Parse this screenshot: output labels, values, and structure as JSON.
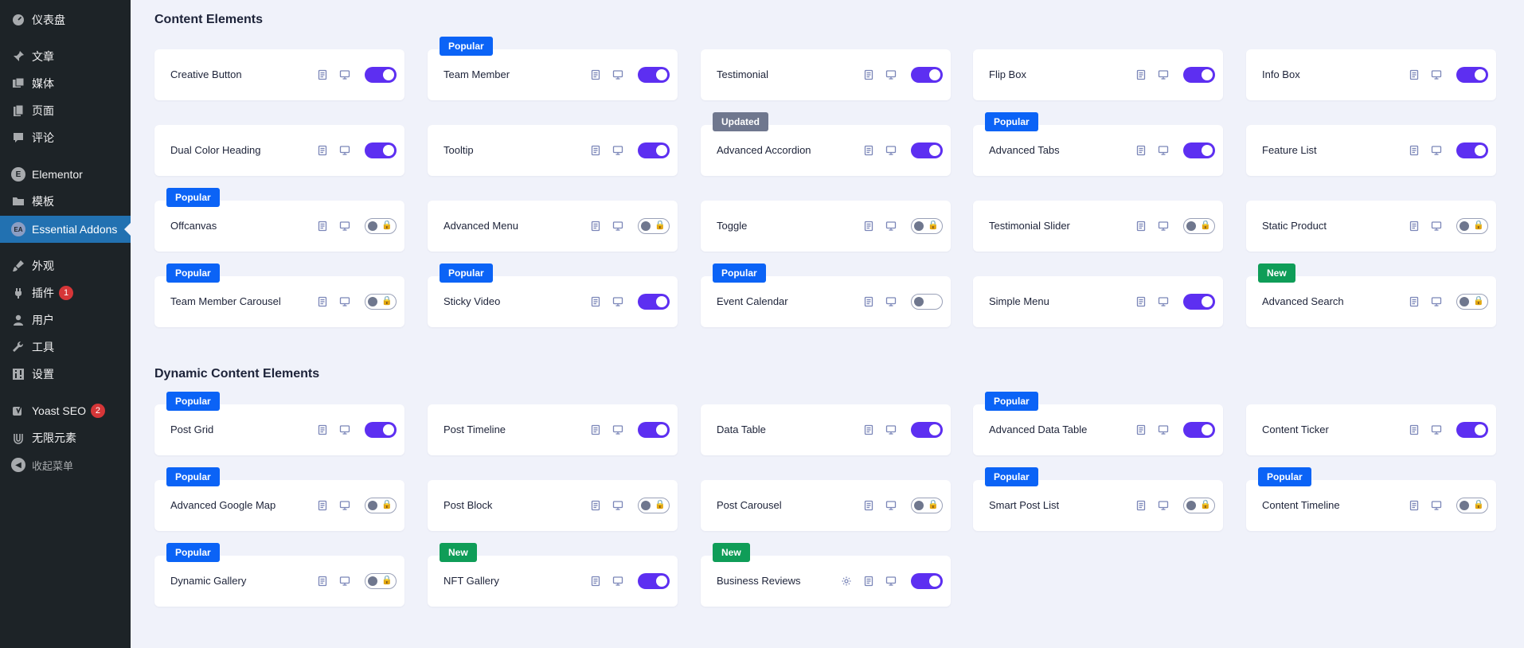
{
  "sidebar": {
    "items": [
      {
        "label": "仪表盘",
        "icon": "dashboard-icon"
      },
      {
        "label": "文章",
        "icon": "pin-icon"
      },
      {
        "label": "媒体",
        "icon": "media-icon"
      },
      {
        "label": "页面",
        "icon": "page-icon"
      },
      {
        "label": "评论",
        "icon": "comment-icon"
      },
      {
        "label": "Elementor",
        "icon": "elementor-icon"
      },
      {
        "label": "模板",
        "icon": "folder-icon"
      },
      {
        "label": "Essential Addons",
        "icon": "essential-addons-icon",
        "active": true
      },
      {
        "label": "外观",
        "icon": "brush-icon"
      },
      {
        "label": "插件",
        "icon": "plugin-icon",
        "badge": "1"
      },
      {
        "label": "用户",
        "icon": "user-icon"
      },
      {
        "label": "工具",
        "icon": "wrench-icon"
      },
      {
        "label": "设置",
        "icon": "settings-icon"
      },
      {
        "label": "Yoast SEO",
        "icon": "yoast-icon",
        "badge": "2"
      },
      {
        "label": "无限元素",
        "icon": "unlimited-elements-icon"
      },
      {
        "label": "收起菜单",
        "icon": "collapse-icon"
      }
    ]
  },
  "sections": [
    {
      "title": "Content Elements",
      "cards": [
        {
          "label": "Creative Button",
          "state": "on",
          "tag": ""
        },
        {
          "label": "Team Member",
          "state": "on",
          "tag": "Popular"
        },
        {
          "label": "Testimonial",
          "state": "on",
          "tag": ""
        },
        {
          "label": "Flip Box",
          "state": "on",
          "tag": ""
        },
        {
          "label": "Info Box",
          "state": "on",
          "tag": ""
        },
        {
          "label": "Dual Color Heading",
          "state": "on",
          "tag": ""
        },
        {
          "label": "Tooltip",
          "state": "on",
          "tag": ""
        },
        {
          "label": "Advanced Accordion",
          "state": "on",
          "tag": "Updated"
        },
        {
          "label": "Advanced Tabs",
          "state": "on",
          "tag": "Popular"
        },
        {
          "label": "Feature List",
          "state": "on",
          "tag": ""
        },
        {
          "label": "Offcanvas",
          "state": "locked",
          "tag": "Popular"
        },
        {
          "label": "Advanced Menu",
          "state": "locked",
          "tag": ""
        },
        {
          "label": "Toggle",
          "state": "locked",
          "tag": ""
        },
        {
          "label": "Testimonial Slider",
          "state": "locked",
          "tag": ""
        },
        {
          "label": "Static Product",
          "state": "locked",
          "tag": ""
        },
        {
          "label": "Team Member Carousel",
          "state": "locked",
          "tag": "Popular"
        },
        {
          "label": "Sticky Video",
          "state": "on",
          "tag": "Popular"
        },
        {
          "label": "Event Calendar",
          "state": "off",
          "tag": "Popular"
        },
        {
          "label": "Simple Menu",
          "state": "on",
          "tag": ""
        },
        {
          "label": "Advanced Search",
          "state": "locked",
          "tag": "New"
        }
      ]
    },
    {
      "title": "Dynamic Content Elements",
      "cards": [
        {
          "label": "Post Grid",
          "state": "on",
          "tag": "Popular"
        },
        {
          "label": "Post Timeline",
          "state": "on",
          "tag": ""
        },
        {
          "label": "Data Table",
          "state": "on",
          "tag": ""
        },
        {
          "label": "Advanced Data Table",
          "state": "on",
          "tag": "Popular"
        },
        {
          "label": "Content Ticker",
          "state": "on",
          "tag": ""
        },
        {
          "label": "Advanced Google Map",
          "state": "locked",
          "tag": "Popular"
        },
        {
          "label": "Post Block",
          "state": "locked",
          "tag": ""
        },
        {
          "label": "Post Carousel",
          "state": "locked",
          "tag": ""
        },
        {
          "label": "Smart Post List",
          "state": "locked",
          "tag": "Popular"
        },
        {
          "label": "Content Timeline",
          "state": "locked",
          "tag": "Popular"
        },
        {
          "label": "Dynamic Gallery",
          "state": "locked",
          "tag": "Popular"
        },
        {
          "label": "NFT Gallery",
          "state": "on",
          "tag": "New"
        },
        {
          "label": "Business Reviews",
          "state": "on",
          "tag": "New",
          "settings": true
        }
      ]
    }
  ],
  "colors": {
    "popular": "#0b63f6",
    "new": "#0f9d58",
    "updated": "#6f778e",
    "toggle_on": "#5d2ff1",
    "sidebar_bg": "#1d2327",
    "active_bg": "#2271b1"
  }
}
